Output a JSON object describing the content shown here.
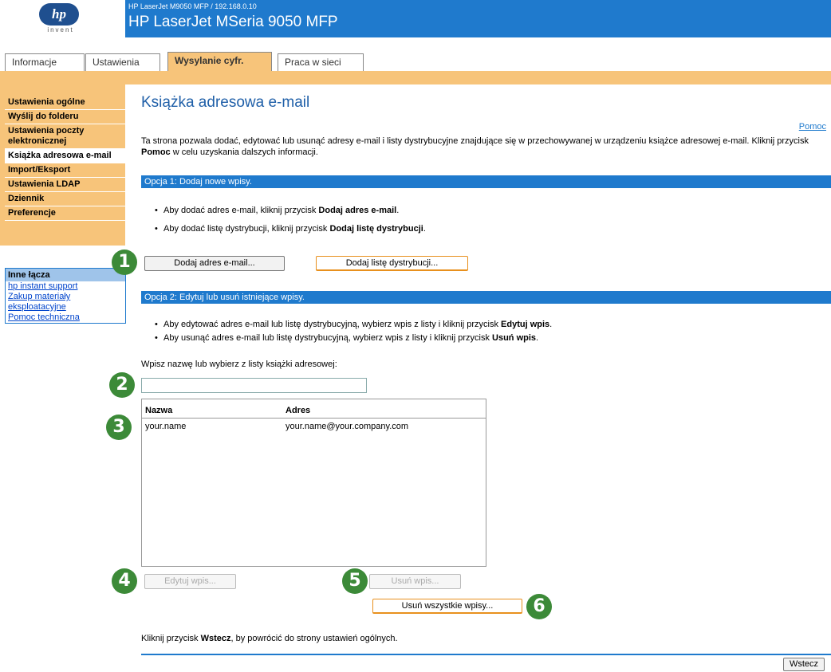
{
  "header": {
    "logo_text": "hp",
    "logo_sub": "invent",
    "device_line": "HP LaserJet M9050 MFP / 192.168.0.10",
    "device_name": "HP LaserJet MSeria 9050 MFP"
  },
  "tabs": [
    {
      "label": "Informacje"
    },
    {
      "label": "Ustawienia"
    },
    {
      "label": "Wysylanie cyfr."
    },
    {
      "label": "Praca w sieci"
    }
  ],
  "nav": {
    "items": [
      {
        "label": "Ustawienia ogólne"
      },
      {
        "label": "Wyślij do folderu"
      },
      {
        "label": "Ustawienia poczty elektronicznej"
      },
      {
        "label": "Książka adresowa e-mail"
      },
      {
        "label": "Import/Eksport"
      },
      {
        "label": "Ustawienia LDAP"
      },
      {
        "label": "Dziennik"
      },
      {
        "label": "Preferencje"
      }
    ]
  },
  "other_links": {
    "title": "Inne łącza",
    "items": [
      {
        "label": "hp instant support"
      },
      {
        "label": "Zakup materiały eksploatacyjne"
      },
      {
        "label": "Pomoc techniczna"
      }
    ]
  },
  "page": {
    "title": "Książka adresowa e-mail",
    "help_link": "Pomoc",
    "intro_1": "Ta strona pozwala dodać, edytować lub usunąć adresy e-mail i listy dystrybucyjne znajdujące się w przechowywanej w urządzeniu książce adresowej e-mail. Kliknij przycisk ",
    "intro_bold": "Pomoc",
    "intro_2": " w celu uzyskania dalszych informacji."
  },
  "option1": {
    "title": "Opcja 1: Dodaj nowe wpisy.",
    "bullet1_a": "Aby dodać adres e-mail, kliknij przycisk ",
    "bullet1_b": "Dodaj adres e-mail",
    "bullet2_a": "Aby dodać listę dystrybucji, kliknij przycisk ",
    "bullet2_b": "Dodaj listę dystrybucji",
    "add_email_button": "Dodaj adres e-mail...",
    "add_list_button": "Dodaj listę dystrybucji..."
  },
  "option2": {
    "title": "Opcja 2: Edytuj lub usuń istniejące wpisy.",
    "bullet1_a": "Aby edytować adres e-mail lub listę dystrybucyjną, wybierz wpis z listy i kliknij przycisk ",
    "bullet1_b": "Edytuj wpis",
    "bullet2_a": "Aby usunąć adres e-mail lub listę dystrybucyjną, wybierz wpis z listy i kliknij przycisk ",
    "bullet2_b": "Usuń wpis",
    "search_label": "Wpisz nazwę lub wybierz z listy książki adresowej:",
    "search_value": "",
    "columns": [
      "Nazwa",
      "Adres"
    ],
    "rows": [
      {
        "name": "your.name",
        "address": "your.name@your.company.com"
      }
    ],
    "edit_button": "Edytuj wpis...",
    "delete_button": "Usuń wpis...",
    "delete_all_button": "Usuń wszystkie wpisy..."
  },
  "footer": {
    "text_a": "Kliknij przycisk ",
    "text_b": "Wstecz",
    "text_c": ", by powrócić do strony ustawień ogólnych.",
    "back_button": "Wstecz"
  },
  "callouts": [
    "1",
    "2",
    "3",
    "4",
    "5",
    "6"
  ],
  "colors": {
    "brand_blue": "#1f7acd",
    "orange": "#f7c47a",
    "callout_green": "#3c8a38"
  }
}
